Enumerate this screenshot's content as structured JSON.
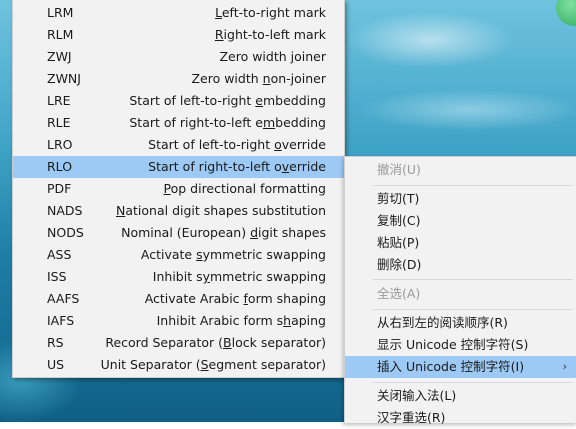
{
  "submenu": {
    "items": [
      {
        "code": "LRM",
        "pre": "",
        "u": "L",
        "post": "eft-to-right mark"
      },
      {
        "code": "RLM",
        "pre": "",
        "u": "R",
        "post": "ight-to-left mark"
      },
      {
        "code": "ZWJ",
        "pre": "Zero width ",
        "u": "j",
        "post": "oiner"
      },
      {
        "code": "ZWNJ",
        "pre": "Zero width ",
        "u": "n",
        "post": "on-joiner"
      },
      {
        "code": "LRE",
        "pre": "Start of left-to-right ",
        "u": "e",
        "post": "mbedding"
      },
      {
        "code": "RLE",
        "pre": "Start of right-to-left e",
        "u": "m",
        "post": "bedding"
      },
      {
        "code": "LRO",
        "pre": "Start of left-to-right ",
        "u": "o",
        "post": "verride"
      },
      {
        "code": "RLO",
        "pre": "Start of right-to-left o",
        "u": "v",
        "post": "erride"
      },
      {
        "code": "PDF",
        "pre": "",
        "u": "P",
        "post": "op directional formatting"
      },
      {
        "code": "NADS",
        "pre": "",
        "u": "N",
        "post": "ational digit shapes substitution"
      },
      {
        "code": "NODS",
        "pre": "Nominal (European) ",
        "u": "d",
        "post": "igit shapes"
      },
      {
        "code": "ASS",
        "pre": "Activate ",
        "u": "s",
        "post": "ymmetric swapping"
      },
      {
        "code": "ISS",
        "pre": "Inhibit s",
        "u": "y",
        "post": "mmetric swapping"
      },
      {
        "code": "AAFS",
        "pre": "Activate Arabic ",
        "u": "f",
        "post": "orm shaping"
      },
      {
        "code": "IAFS",
        "pre": "Inhibit Arabic form s",
        "u": "h",
        "post": "aping"
      },
      {
        "code": "RS",
        "pre": "Record Separator (",
        "u": "B",
        "post": "lock separator)"
      },
      {
        "code": "US",
        "pre": "Unit Separator (",
        "u": "S",
        "post": "egment separator)"
      }
    ],
    "selected_index": 7
  },
  "context_menu": {
    "undo": "撤消(U)",
    "cut": "剪切(T)",
    "copy": "复制(C)",
    "paste": "粘贴(P)",
    "delete": "删除(D)",
    "select_all": "全选(A)",
    "rtl": "从右到左的阅读顺序(R)",
    "show_unicode": "显示 Unicode 控制字符(S)",
    "insert_unicode": "插入 Unicode 控制字符(I)",
    "close_ime": "关闭输入法(L)",
    "reconvert": "汉字重选(R)",
    "submenu_arrow": "›"
  }
}
